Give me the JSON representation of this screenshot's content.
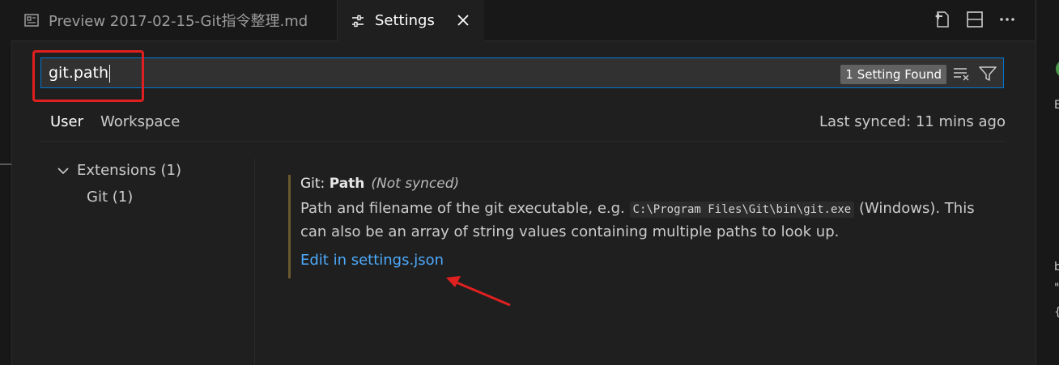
{
  "tabs": [
    {
      "label": "Preview 2017-02-15-Git指令整理.md",
      "icon": "preview-icon",
      "active": false
    },
    {
      "label": "Settings",
      "icon": "settings-sliders-icon",
      "active": true
    }
  ],
  "editor_actions": [
    "open-settings-json-icon",
    "split-editor-icon",
    "more-actions-icon"
  ],
  "search": {
    "value": "git.path",
    "result_badge": "1 Setting Found",
    "clear_icon": "clear-filter-icon",
    "filter_icon": "filter-icon"
  },
  "scopes": {
    "user": "User",
    "workspace": "Workspace"
  },
  "last_synced": "Last synced: 11 mins ago",
  "toc": {
    "extensions": "Extensions (1)",
    "git": "Git (1)"
  },
  "setting": {
    "category": "Git: ",
    "name": "Path",
    "sync_state": "(Not synced)",
    "desc_before": "Path and filename of the git executable, e.g. ",
    "desc_code": "C:\\Program Files\\Git\\bin\\git.exe",
    "desc_after": " (Windows). This can also be an array of string values containing multiple paths to look up.",
    "link": "Edit in settings.json"
  },
  "annotation_color": "#e02020",
  "accent_color": "#0078d4",
  "link_color": "#4daafc",
  "right_strip": {
    "glyph_top": "E",
    "glyph_mid": "b",
    "glyph_quote": "\"",
    "glyph_brace": "{"
  }
}
